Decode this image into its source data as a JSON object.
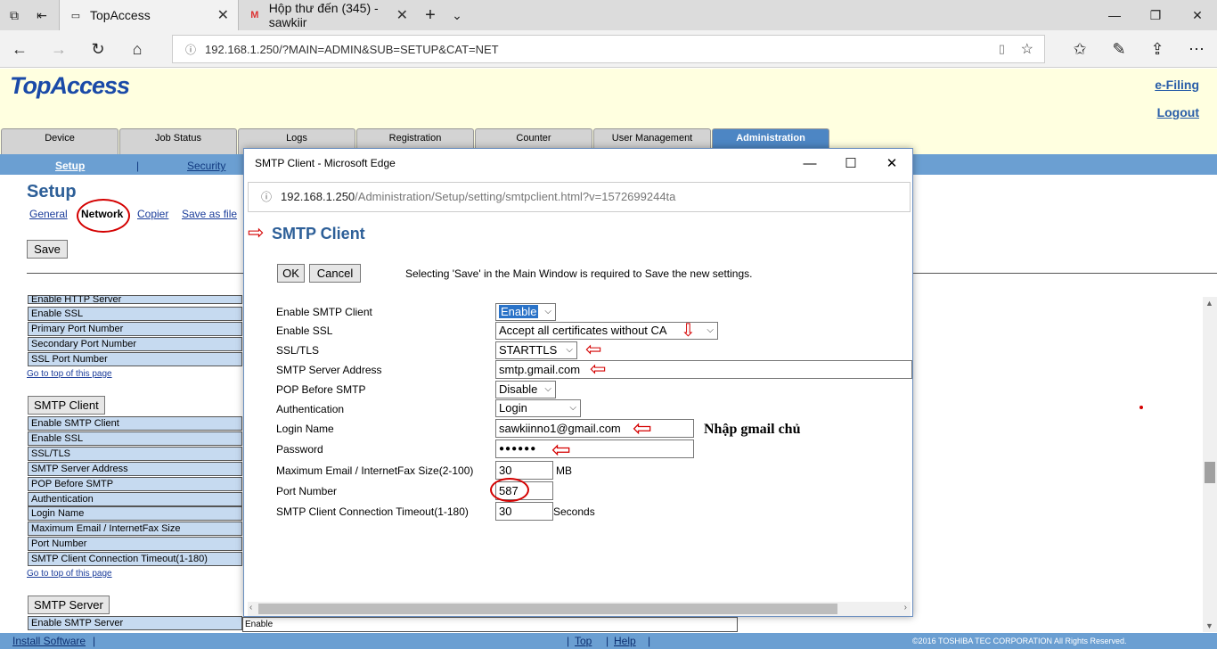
{
  "browser": {
    "tabs": [
      {
        "title": "TopAccess"
      },
      {
        "title": "Hộp thư đến (345) - sawkiir"
      }
    ],
    "url": "192.168.1.250/?MAIN=ADMIN&SUB=SETUP&CAT=NET"
  },
  "header": {
    "logo": "TopAccess",
    "efiling": "e-Filing",
    "logout": "Logout"
  },
  "main_tabs": [
    "Device",
    "Job Status",
    "Logs",
    "Registration",
    "Counter",
    "User Management",
    "Administration"
  ],
  "subnav": {
    "setup": "Setup",
    "sep": "|",
    "security": "Security"
  },
  "setup": {
    "title": "Setup",
    "links": [
      "General",
      "Network",
      "Copier",
      "Save as file"
    ],
    "save": "Save"
  },
  "left_rows_top": [
    "Enable HTTP Server",
    "Enable SSL",
    "Primary Port Number",
    "Secondary Port Number",
    "SSL Port Number"
  ],
  "goto_top": "Go to top of this page",
  "smtp_client_section": "SMTP Client",
  "left_rows_smtp": [
    "Enable SMTP Client",
    "Enable SSL",
    "SSL/TLS",
    "SMTP Server Address",
    "POP Before SMTP",
    "Authentication",
    "Login Name",
    "Maximum Email / InternetFax Size",
    "Port Number",
    "SMTP Client Connection Timeout(1-180)"
  ],
  "smtp_server_section": "SMTP Server",
  "left_rows_server": [
    "Enable SMTP Server"
  ],
  "under_value": "Enable",
  "status": {
    "install": " Install Software",
    "top": " Top ",
    "help": " Help ",
    "copyright": "©2016 TOSHIBA TEC CORPORATION All Rights Reserved."
  },
  "popup": {
    "title": "SMTP Client - Microsoft Edge",
    "url_host": "192.168.1.250",
    "url_path": "/Administration/Setup/setting/smtpclient.html?v=1572699244ta",
    "heading": "SMTP Client",
    "ok": "OK",
    "cancel": "Cancel",
    "note": "Selecting 'Save' in the Main Window is required to Save the new settings.",
    "fields": {
      "enable_smtp_label": "Enable SMTP Client",
      "enable_smtp_value": "Enable",
      "enable_ssl_label": "Enable SSL",
      "enable_ssl_value": "Accept all certificates without CA",
      "ssl_tls_label": "SSL/TLS",
      "ssl_tls_value": "STARTTLS",
      "server_label": "SMTP Server Address",
      "server_value": "smtp.gmail.com",
      "pop_label": "POP Before SMTP",
      "pop_value": "Disable",
      "auth_label": "Authentication",
      "auth_value": "Login",
      "login_label": "Login Name",
      "login_value": "sawkiinno1@gmail.com",
      "password_label": "Password",
      "password_value": "●●●●●●",
      "maxsize_label": "Maximum Email / InternetFax Size(2-100)",
      "maxsize_value": "30",
      "maxsize_unit": "MB",
      "port_label": "Port Number",
      "port_value": "587",
      "timeout_label": "SMTP Client Connection Timeout(1-180)",
      "timeout_value": "30",
      "timeout_unit": "Seconds"
    },
    "annotation": "Nhập gmail chủ"
  },
  "colors": {
    "accent": "#2d5f98",
    "subnav": "#6b9fd2",
    "header_bg": "#ffffe0",
    "annotation": "#d40000"
  }
}
